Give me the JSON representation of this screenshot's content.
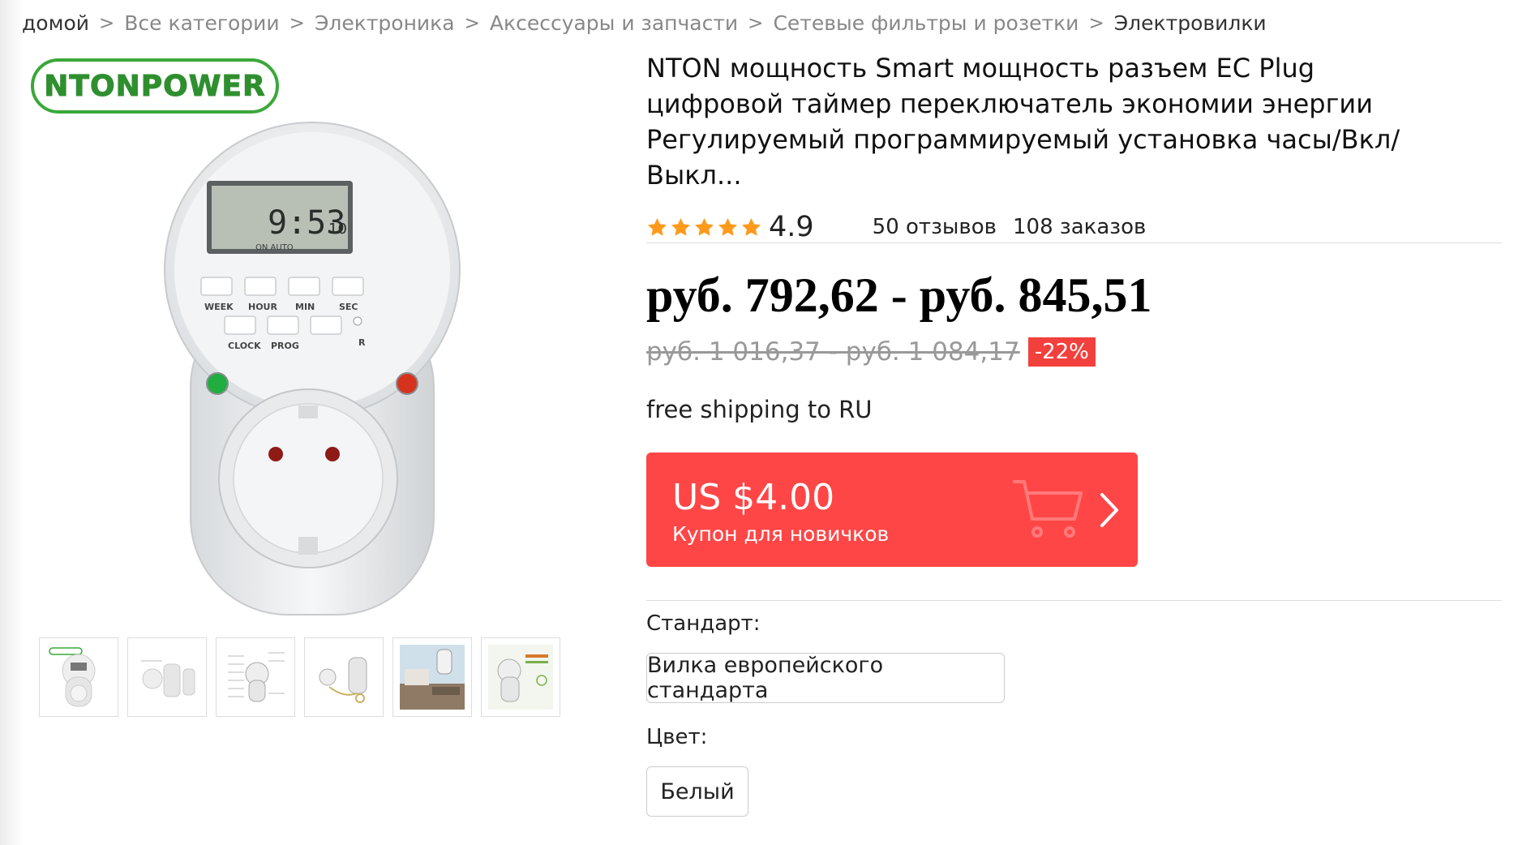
{
  "breadcrumb": {
    "items": [
      "домой",
      "Все категории",
      "Электроника",
      "Аксессуары и запчасти",
      "Сетевые фильтры и розетки",
      "Электровилки"
    ],
    "separator": ">"
  },
  "gallery": {
    "brand": "NTONPOWER",
    "thumbnail_count": 6
  },
  "product": {
    "title": "NTON мощность Smart мощность разъем EC Plug цифровой таймер переключатель экономии энергии Регулируемый программируемый установка часы/Вкл/Выкл...",
    "rating": "4.9",
    "rating_stars": 5,
    "reviews": "50 отзывов",
    "orders": "108 заказов",
    "price": "руб. 792,62 - руб. 845,51",
    "old_price": "руб. 1 016,37 - руб. 1 084,17",
    "discount": "-22%",
    "shipping": "free shipping to RU"
  },
  "coupon": {
    "amount": "US $4.00",
    "label": "Купон для новичков"
  },
  "properties": {
    "standard_label": "Стандарт:",
    "standard_option": "Вилка европейского стандарта",
    "color_label": "Цвет:",
    "color_option": "Белый"
  },
  "colors": {
    "accent_red": "#ff4646",
    "discount_red": "#f2403d",
    "star_orange": "#ff9a1a",
    "brand_green": "#3aa83a"
  }
}
